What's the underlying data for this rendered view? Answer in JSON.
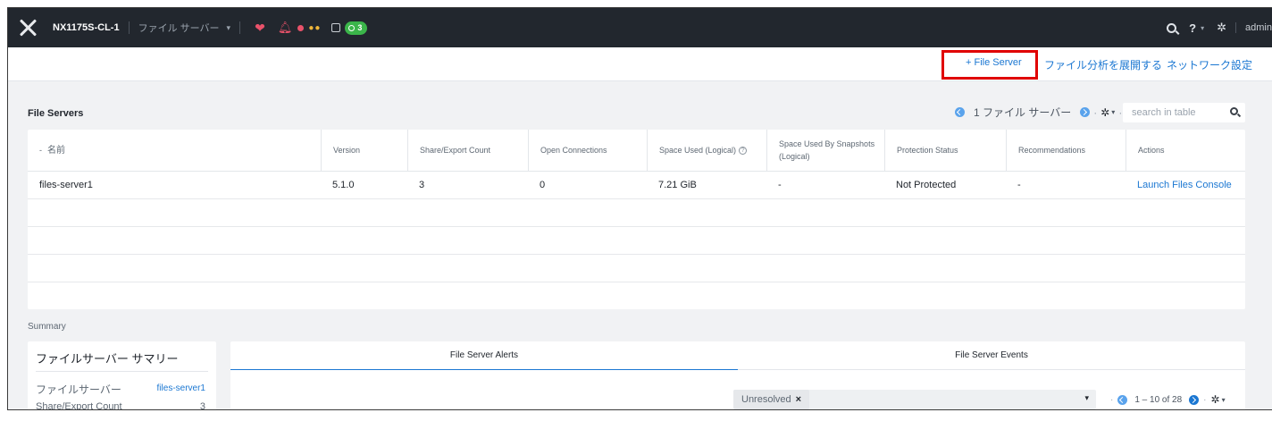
{
  "topbar": {
    "cluster_name": "NX1175S-CL-1",
    "section": "ファイル サーバー",
    "task_count": "3",
    "user": "admin"
  },
  "actionbar": {
    "add_file_server": "+ File Server",
    "deploy_analytics": "ファイル分析を展開する",
    "network_settings": "ネットワーク設定"
  },
  "file_servers": {
    "title": "File Servers",
    "pager_text": "1 ファイル サーバー",
    "search_placeholder": "search in table",
    "columns": [
      "名前",
      "Version",
      "Share/Export Count",
      "Open Connections",
      "Space Used (Logical)",
      "Space Used By Snapshots (Logical)",
      "Protection Status",
      "Recommendations",
      "Actions"
    ],
    "sort_indicator": "-",
    "rows": [
      {
        "name": "files-server1",
        "version": "5.1.0",
        "share_count": "3",
        "open_connections": "0",
        "space_used": "7.21 GiB",
        "snapshot_space": "-",
        "protection": "Not Protected",
        "recommendations": "-",
        "action": "Launch Files Console"
      }
    ]
  },
  "summary": {
    "label": "Summary",
    "card_title": "ファイルサーバー サマリー",
    "rows": [
      {
        "label": "ファイルサーバー",
        "value": "files-server1"
      },
      {
        "label": "Share/Export Count",
        "value": "3"
      }
    ]
  },
  "alerts": {
    "tabs": [
      "File Server Alerts",
      "File Server Events"
    ],
    "filter_chip": "Unresolved",
    "pager_text": "1 – 10 of 28"
  },
  "colors": {
    "accent": "#1b77d2",
    "topbar": "#22272e",
    "critical": "#e9526a",
    "success": "#3bb54a",
    "highlight_box": "#e00000"
  }
}
